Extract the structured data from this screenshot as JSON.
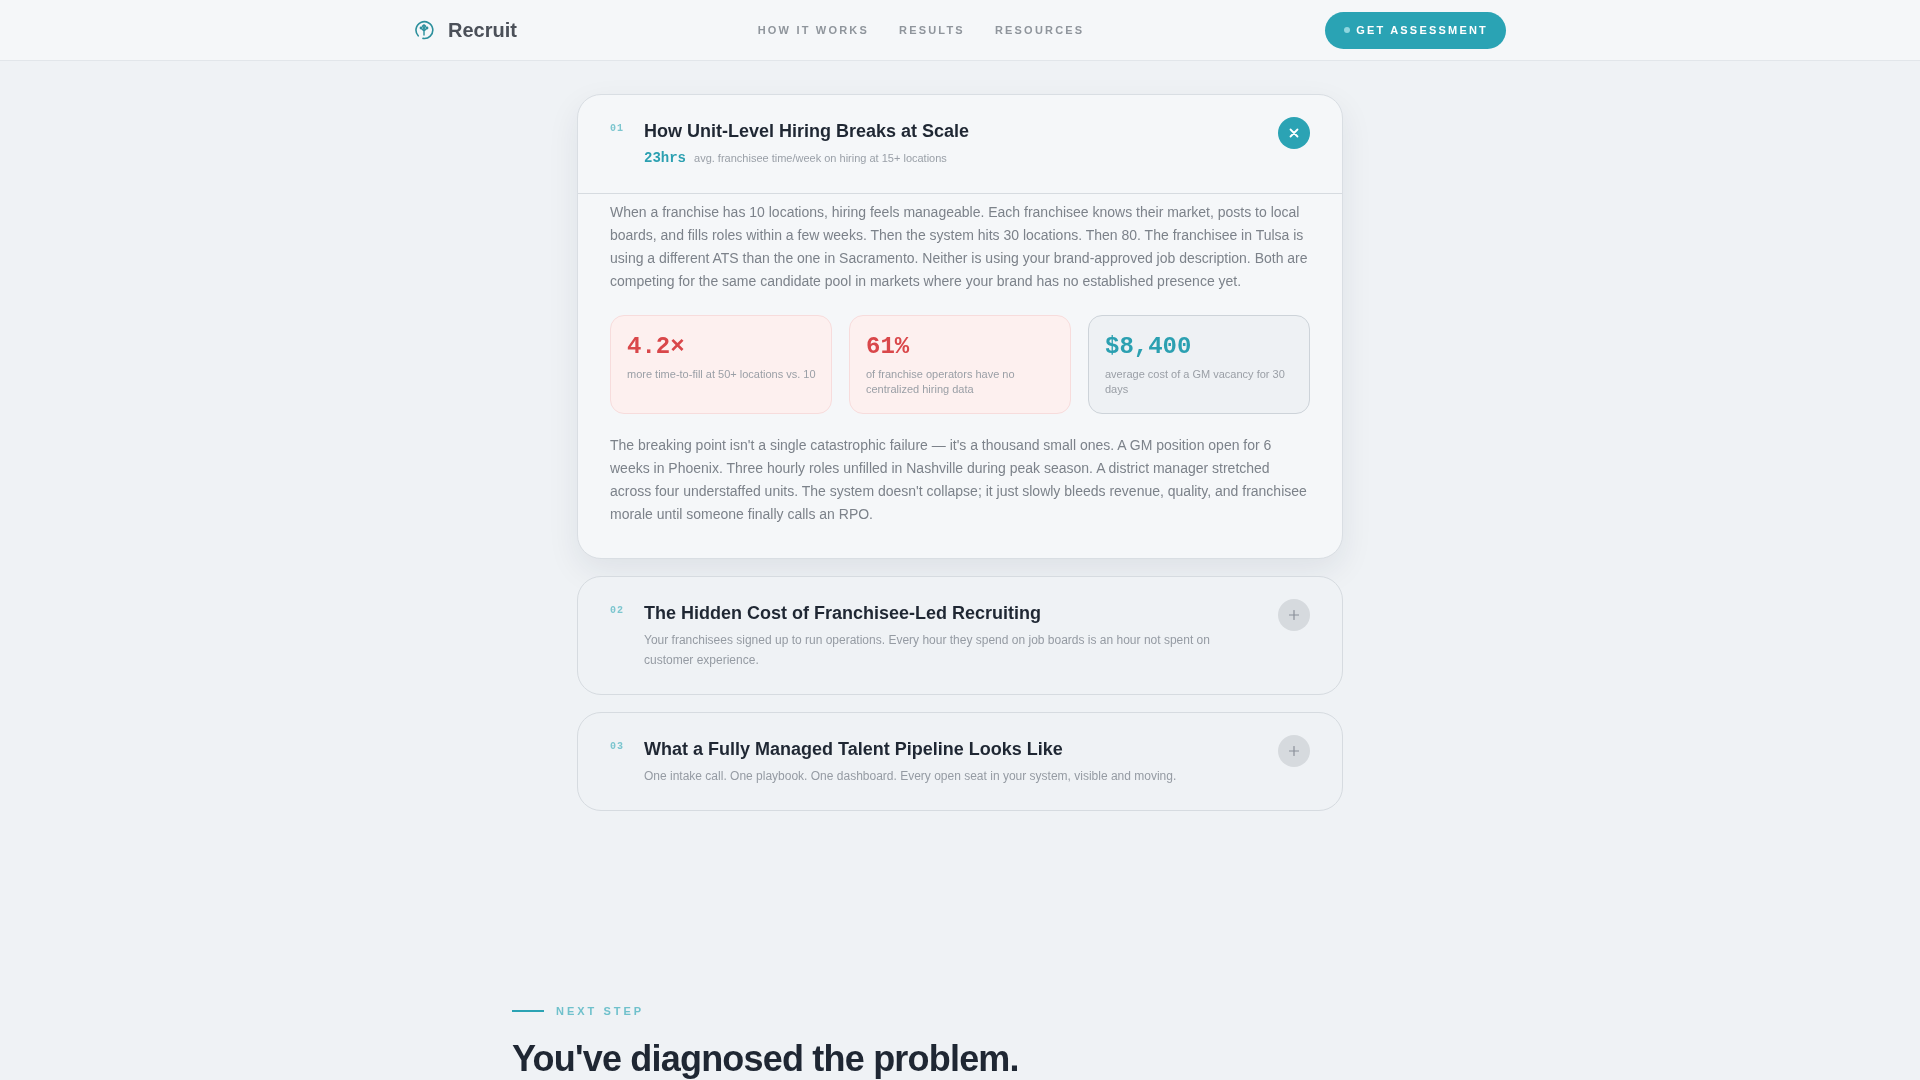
{
  "nav": {
    "brand": "Recruit",
    "links": [
      "HOW IT WORKS",
      "RESULTS",
      "RESOURCES"
    ],
    "cta": "GET ASSESSMENT"
  },
  "items": [
    {
      "number": "01",
      "title": "How Unit-Level Hiring Breaks at Scale",
      "expanded": true,
      "metric": {
        "value": "23hrs",
        "label": "avg. franchisee time/week on hiring at 15+ locations"
      },
      "body": [
        {
          "kind": "paragraph",
          "text": "When a franchise has 10 locations, hiring feels manageable. Each franchisee knows their market, posts to local boards, and fills roles within a few weeks. Then the system hits 30 locations. Then 80. The franchisee in Tulsa is using a different ATS than the one in Sacramento. Neither is using your brand-approved job description. Both are competing for the same candidate pool in markets where your brand has no established presence yet."
        },
        {
          "kind": "stats",
          "stats": [
            {
              "kind": "alert",
              "value": "4.2×",
              "label": "more time-to-fill at 50+ locations vs. 10"
            },
            {
              "kind": "alert",
              "value": "61%",
              "label": "of franchise operators have no centralized hiring data"
            },
            {
              "kind": "info",
              "value": "$8,400",
              "label": "average cost of a GM vacancy for 30 days"
            }
          ]
        },
        {
          "kind": "paragraph",
          "text": "The breaking point isn't a single catastrophic failure — it's a thousand small ones. A GM position open for 6 weeks in Phoenix. Three hourly roles unfilled in Nashville during peak season. A district manager stretched across four understaffed units. The system doesn't collapse; it just slowly bleeds revenue, quality, and franchisee morale until someone finally calls an RPO."
        }
      ]
    },
    {
      "number": "02",
      "title": "The Hidden Cost of Franchisee-Led Recruiting",
      "expanded": false,
      "summary": "Your franchisees signed up to run operations. Every hour they spend on job boards is an hour not spent on customer experience."
    },
    {
      "number": "03",
      "title": "What a Fully Managed Talent Pipeline Looks Like",
      "expanded": false,
      "summary": "One intake call. One playbook. One dashboard. Every open seat in your system, visible and moving."
    }
  ],
  "next_step": {
    "eyebrow": "NEXT STEP",
    "heading": "You've diagnosed the problem."
  }
}
